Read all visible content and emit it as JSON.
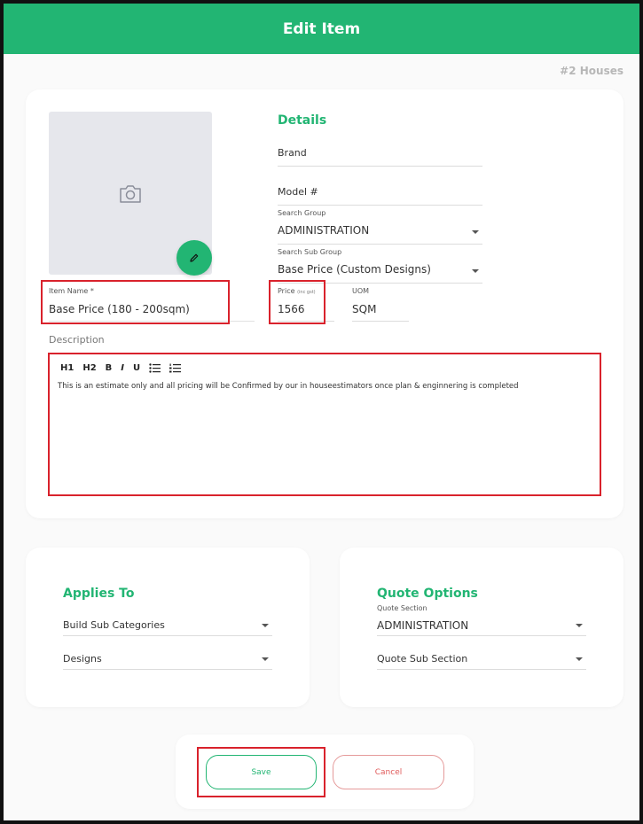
{
  "header": {
    "title": "Edit Item"
  },
  "reference": "#2 Houses",
  "details": {
    "title": "Details",
    "brand_placeholder": "Brand",
    "model_placeholder": "Model #",
    "search_group": {
      "label": "Search Group",
      "value": "ADMINISTRATION"
    },
    "search_sub_group": {
      "label": "Search Sub Group",
      "value": "Base Price (Custom Designs)"
    },
    "item_name": {
      "label": "Item Name *",
      "value": "Base Price (180 - 200sqm)"
    },
    "price": {
      "label": "Price",
      "sublabel": "(inc gst)",
      "value": "1566"
    },
    "uom": {
      "label": "UOM",
      "value": "SQM"
    }
  },
  "description": {
    "label": "Description",
    "toolbar": [
      "H1",
      "H2",
      "B",
      "I",
      "U"
    ],
    "text": "This is an estimate only and all pricing will be Confirmed by our in houseestimators once plan & enginnering is completed"
  },
  "applies_to": {
    "title": "Applies To",
    "build_sub_categories": "Build Sub Categories",
    "designs": "Designs"
  },
  "quote_options": {
    "title": "Quote Options",
    "quote_section": {
      "label": "Quote Section",
      "value": "ADMINISTRATION"
    },
    "quote_sub_section": "Quote Sub Section"
  },
  "actions": {
    "save": "Save",
    "cancel": "Cancel"
  },
  "icons": [
    "camera-icon",
    "pencil-icon",
    "chevron-down-icon",
    "bullet-list-icon",
    "numbered-list-icon"
  ],
  "colors": {
    "accent": "#22b573",
    "highlight": "#d9222c",
    "cancel": "#e05a5a"
  }
}
